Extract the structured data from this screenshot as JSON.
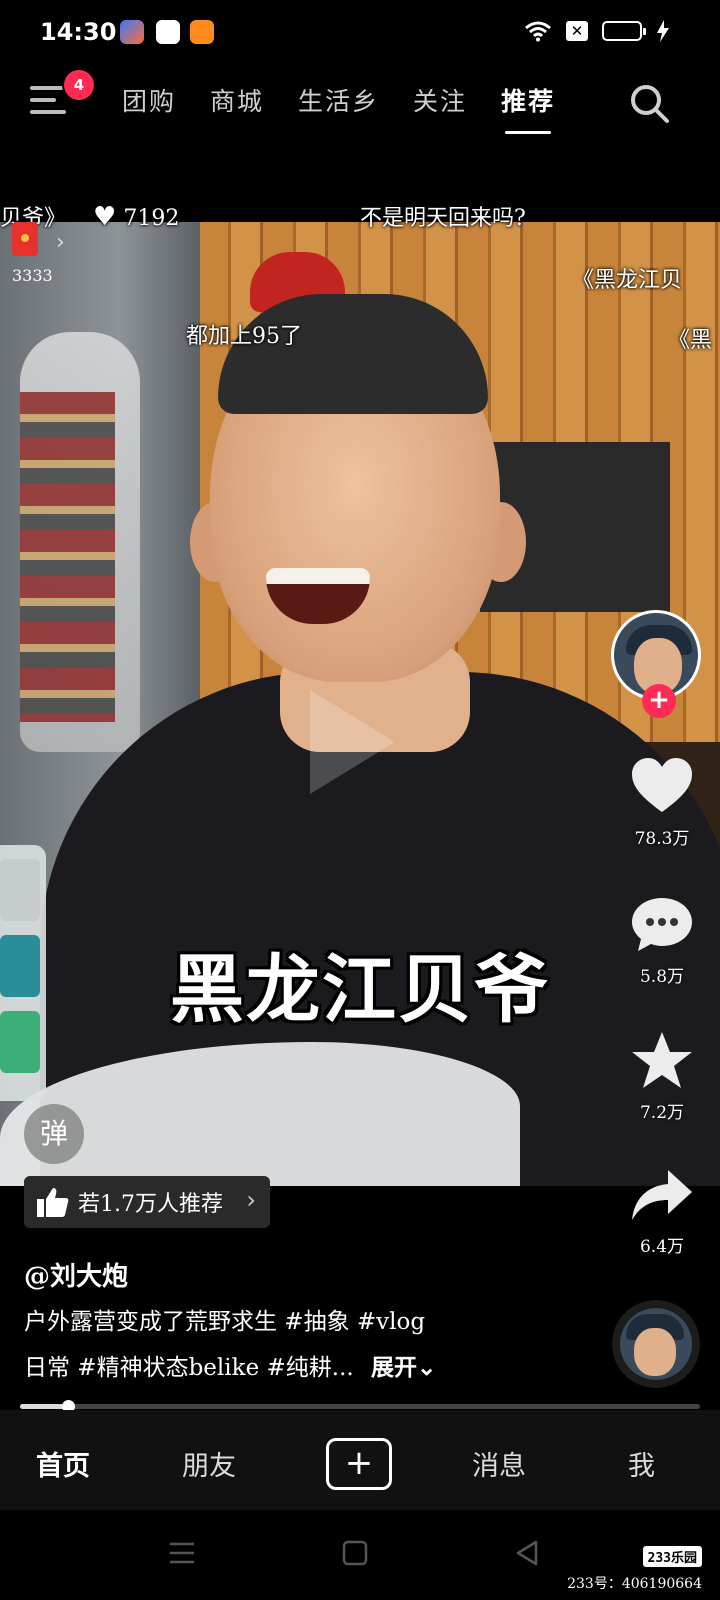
{
  "status_bar": {
    "time": "14:30",
    "app_icons": [
      "app-icon-1",
      "app-icon-2",
      "app-icon-3"
    ],
    "icons": [
      "wifi-icon",
      "close-box-icon",
      "battery-icon",
      "charging-icon"
    ]
  },
  "top_nav": {
    "badge_count": "4",
    "tabs": [
      "团购",
      "商城",
      "生活乡",
      "关注",
      "推荐"
    ],
    "active_tab": "推荐"
  },
  "danmaku": {
    "d1": "贝爷》",
    "d1_likes": "7192",
    "d2": "不是明天回来吗?",
    "d3": "都加上95了",
    "d4": "《黑龙江贝",
    "d5": "《黑"
  },
  "live": {
    "viewers": "3333"
  },
  "video": {
    "caption": "黑龙江贝爷",
    "progress_fraction": 0.07
  },
  "right_rail": {
    "like_count": "78.3万",
    "comment_count": "5.8万",
    "favorite_count": "7.2万",
    "share_count": "6.4万"
  },
  "danmu_button": "弹",
  "recommend": {
    "text": "若1.7万人推荐",
    "arrow": "›"
  },
  "author": "@刘大炮",
  "description": {
    "line1": "户外露营变成了荒野求生 #抽象 #vlog",
    "line2": "日常 #精神状态belike #纯耕...",
    "more": "展开⌄"
  },
  "bottom_nav": {
    "home": "首页",
    "friends": "朋友",
    "add": "+",
    "messages": "消息",
    "me": "我"
  },
  "watermark": {
    "brand": "233乐园",
    "id_text": "233号：406190664"
  },
  "colors": {
    "accent_red": "#fe2c55",
    "background": "#000000"
  }
}
